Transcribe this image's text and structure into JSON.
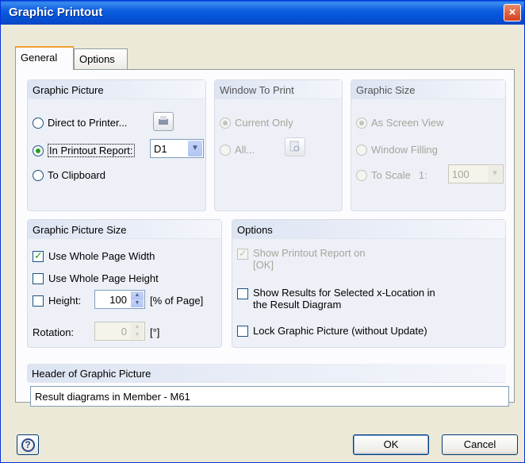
{
  "window": {
    "title": "Graphic Printout",
    "close": "×"
  },
  "tabs": [
    {
      "label": "General"
    },
    {
      "label": "Options"
    }
  ],
  "graphic_picture": {
    "title": "Graphic Picture",
    "direct_label": "Direct to Printer...",
    "report_label": "In Printout Report:",
    "report_value": "D1",
    "clipboard_label": "To Clipboard"
  },
  "window_to_print": {
    "title": "Window To Print",
    "current_label": "Current Only",
    "all_label": "All..."
  },
  "graphic_size": {
    "title": "Graphic Size",
    "screen_label": "As Screen View",
    "filling_label": "Window Filling",
    "scale_label": "To Scale",
    "scale_prefix": "1:",
    "scale_value": "100"
  },
  "picture_size": {
    "title": "Graphic Picture Size",
    "page_width_label": "Use Whole Page Width",
    "page_height_label": "Use Whole Page Height",
    "height_label": "Height:",
    "height_value": "100",
    "height_unit": "[% of Page]",
    "rotation_label": "Rotation:",
    "rotation_value": "0",
    "rotation_unit": "[°]"
  },
  "options": {
    "title": "Options",
    "show_printout_line1": "Show Printout Report on",
    "show_printout_line2": "[OK]",
    "show_results_line1": "Show Results for Selected x-Location in",
    "show_results_line2": "the Result Diagram",
    "lock_label": "Lock Graphic Picture (without Update)"
  },
  "header": {
    "title": "Header of Graphic Picture",
    "value": "Result diagrams in Member -  M61"
  },
  "buttons": {
    "ok": "OK",
    "cancel": "Cancel",
    "help": "?"
  }
}
